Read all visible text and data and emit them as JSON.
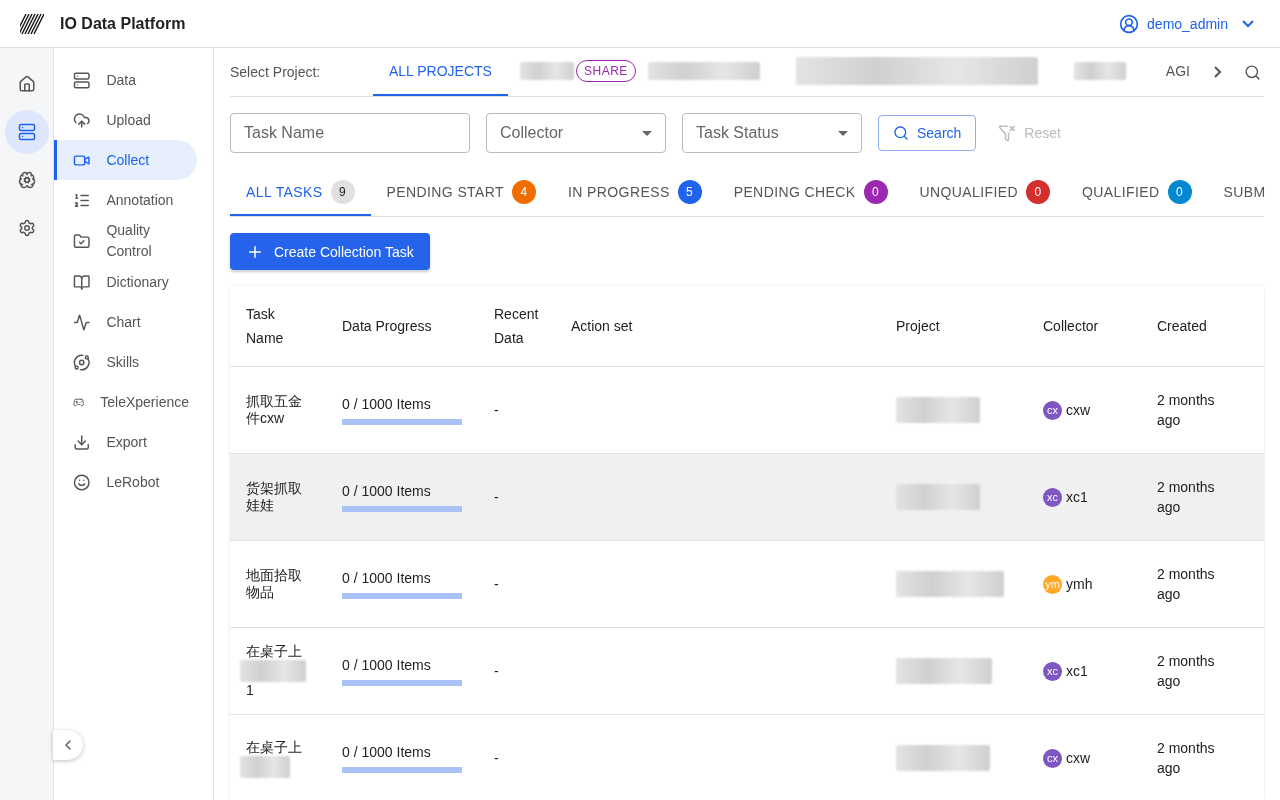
{
  "app": {
    "title": "IO Data Platform",
    "user": "demo_admin"
  },
  "rail": [
    {
      "kind": "home",
      "selected": false
    },
    {
      "kind": "data",
      "selected": true
    },
    {
      "kind": "brain",
      "selected": false
    },
    {
      "kind": "settings",
      "selected": false
    }
  ],
  "nav": [
    {
      "label": "Data",
      "kind": "data",
      "selected": false
    },
    {
      "label": "Upload",
      "kind": "upload",
      "selected": false
    },
    {
      "label": "Collect",
      "kind": "collect",
      "selected": true
    },
    {
      "label": "Annotation",
      "kind": "annotation",
      "selected": false
    },
    {
      "label": "Quality Control",
      "kind": "quality",
      "selected": false
    },
    {
      "label": "Dictionary",
      "kind": "dictionary",
      "selected": false
    },
    {
      "label": "Chart",
      "kind": "chart",
      "selected": false
    },
    {
      "label": "Skills",
      "kind": "skills",
      "selected": false
    },
    {
      "label": "TeleXperience",
      "kind": "gamepad",
      "selected": false
    },
    {
      "label": "Export",
      "kind": "export",
      "selected": false
    },
    {
      "label": "LeRobot",
      "kind": "robot",
      "selected": false
    }
  ],
  "project_bar": {
    "label": "Select Project:",
    "projects": [
      {
        "kind": "text",
        "label": "ALL PROJECTS",
        "selected": true
      },
      {
        "kind": "redacted",
        "chip": "SHARE",
        "selected": false
      },
      {
        "kind": "redacted",
        "selected": false
      },
      {
        "kind": "redacted",
        "selected": false
      },
      {
        "kind": "redacted",
        "selected": false
      },
      {
        "kind": "text",
        "label": "AGI",
        "selected": false
      }
    ]
  },
  "filters": {
    "task_name": {
      "placeholder": "Task Name"
    },
    "collector": {
      "placeholder": "Collector"
    },
    "status": {
      "placeholder": "Task Status"
    },
    "search": "Search",
    "reset": "Reset"
  },
  "status_tabs": [
    {
      "label": "ALL TASKS",
      "count": "9",
      "color": "#e0e0e0",
      "selected": true
    },
    {
      "label": "PENDING START",
      "count": "4",
      "color": "#ef6c00",
      "selected": false
    },
    {
      "label": "IN PROGRESS",
      "count": "5",
      "color": "#1e63e9",
      "selected": false
    },
    {
      "label": "PENDING CHECK",
      "count": "0",
      "color": "#9c27b0",
      "selected": false
    },
    {
      "label": "UNQUALIFIED",
      "count": "0",
      "color": "#d32f2f",
      "selected": false
    },
    {
      "label": "QUALIFIED",
      "count": "0",
      "color": "#0288d1",
      "selected": false
    },
    {
      "label": "SUBM",
      "selected": false
    }
  ],
  "create_button": "Create Collection Task",
  "table": {
    "columns": [
      "Task Name",
      "Data Progress",
      "Recent Data",
      "Action set",
      "Project",
      "Collector",
      "Created"
    ],
    "rows": [
      {
        "task": "抓取五金件cxw",
        "progress": "0 / 1000 Items",
        "level": 0,
        "recent": "-",
        "collector": {
          "initials": "cx",
          "name": "cxw",
          "color": "#7e57c2"
        },
        "created": "2 months ago",
        "highlighted": false
      },
      {
        "task": "货架抓取娃娃",
        "progress": "0 / 1000 Items",
        "level": 0,
        "recent": "-",
        "collector": {
          "initials": "xc",
          "name": "xc1",
          "color": "#7e57c2"
        },
        "created": "2 months ago",
        "highlighted": true
      },
      {
        "task": "地面拾取物品",
        "progress": "0 / 1000 Items",
        "level": 0,
        "recent": "-",
        "collector": {
          "initials": "ym",
          "name": "ymh",
          "color": "#ffa726"
        },
        "created": "2 months ago",
        "highlighted": false
      },
      {
        "task": "在桌子上",
        "task_redacted": true,
        "task_tail": "1",
        "progress": "0 / 1000 Items",
        "level": 0,
        "recent": "-",
        "collector": {
          "initials": "xc",
          "name": "xc1",
          "color": "#7e57c2"
        },
        "created": "2 months ago",
        "highlighted": false
      },
      {
        "task": "在桌子上",
        "task_redacted": true,
        "progress": "0 / 1000 Items",
        "level": 0,
        "recent": "-",
        "collector": {
          "initials": "cx",
          "name": "cxw",
          "color": "#7e57c2"
        },
        "created": "2 months ago",
        "highlighted": false
      }
    ]
  }
}
